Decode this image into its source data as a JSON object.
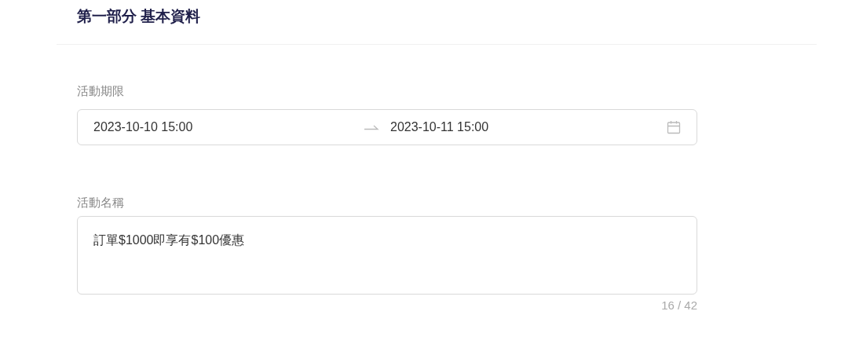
{
  "section": {
    "title": "第一部分 基本資料"
  },
  "period": {
    "label": "活動期限",
    "start": "2023-10-10 15:00",
    "end": "2023-10-11 15:00"
  },
  "name": {
    "label": "活動名稱",
    "value": "訂單$1000即享有$100優惠",
    "count": "16 / 42"
  }
}
